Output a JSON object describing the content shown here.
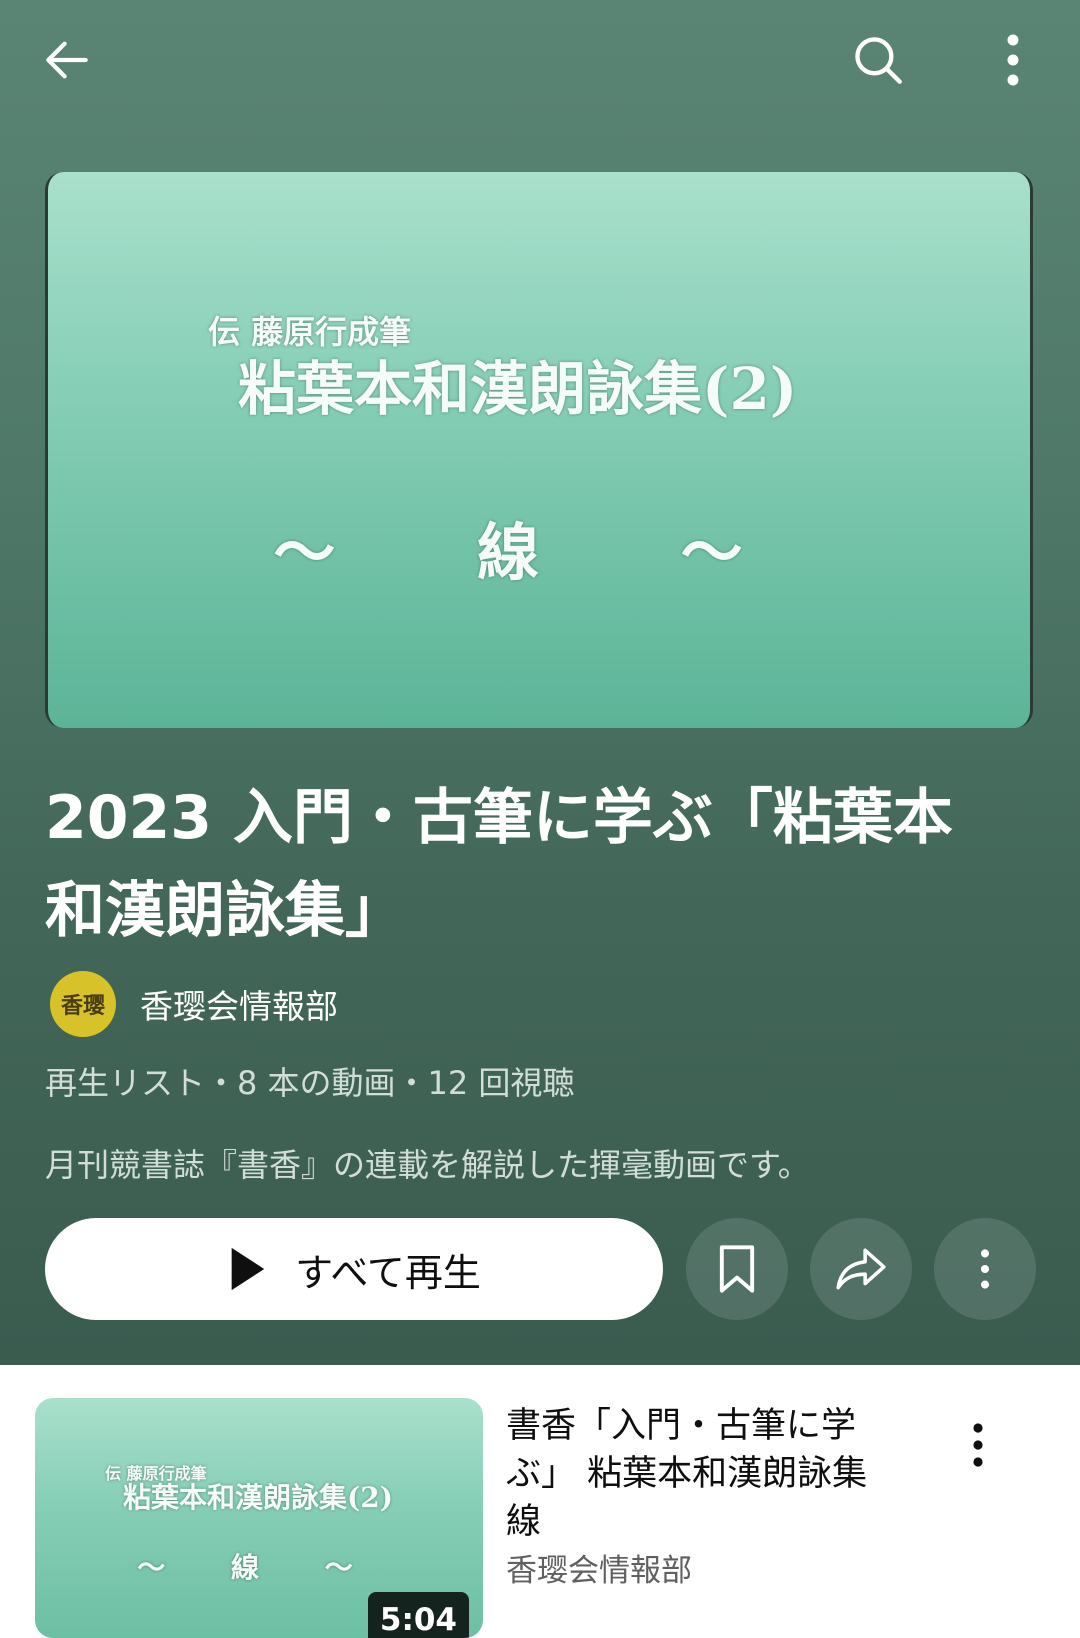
{
  "header": {
    "back_icon": "arrow-left-icon",
    "search_icon": "search-icon",
    "more_icon": "more-vert-icon"
  },
  "hero_thumbnail": {
    "subtitle": "伝 藤原行成筆",
    "title": "粘葉本和漢朗詠集(2)",
    "line": "〜 線 〜"
  },
  "playlist": {
    "title": "2023 入門・古筆に学ぶ「粘葉本和漢朗詠集」",
    "channel": "香璎会情報部",
    "avatar_text": "香璎",
    "meta": "再生リスト・8 本の動画・12 回視聴",
    "description": "月刊競書誌『書香』の連載を解説した揮毫動画です。"
  },
  "actions": {
    "play_all_label": "すべて再生",
    "save_icon": "bookmark-icon",
    "share_icon": "share-icon",
    "options_icon": "more-vert-icon"
  },
  "items": [
    {
      "thumb_subtitle": "伝 藤原行成筆",
      "thumb_title": "粘葉本和漢朗詠集(2)",
      "thumb_line": "〜 線 〜",
      "duration": "5:04",
      "title": "書香「入門・古筆に学ぶ」 粘葉本和漢朗詠集　線",
      "channel": "香璎会情報部"
    }
  ],
  "colors": {
    "header_bg": "#4f7868",
    "thumb_green": "#86ceb6",
    "avatar": "#d8c22a"
  }
}
